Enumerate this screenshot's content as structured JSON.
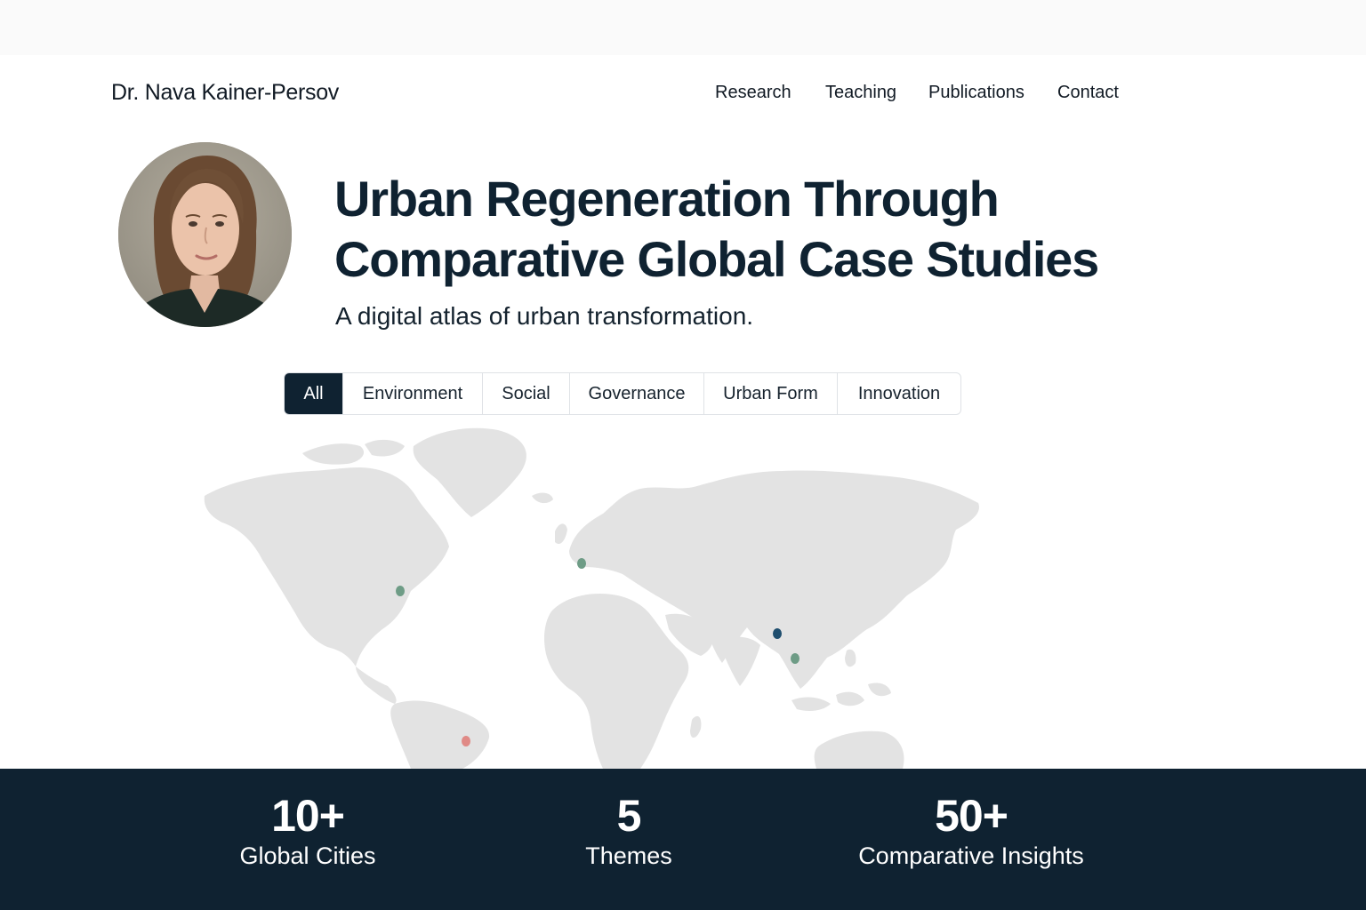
{
  "header": {
    "site_title": "Dr. Nava Kainer-Persov",
    "nav": [
      {
        "label": "Research"
      },
      {
        "label": "Teaching"
      },
      {
        "label": "Publications"
      },
      {
        "label": "Contact"
      }
    ]
  },
  "hero": {
    "title": "Urban Regeneration Through Comparative Global Case Studies",
    "subtitle": "A digital atlas of urban transformation."
  },
  "filters": {
    "selected": "All",
    "items": [
      {
        "label": "All"
      },
      {
        "label": "Environment"
      },
      {
        "label": "Social"
      },
      {
        "label": "Governance"
      },
      {
        "label": "Urban Form"
      },
      {
        "label": "Innovation"
      }
    ]
  },
  "map": {
    "land_color": "#e3e3e3",
    "markers": [
      {
        "name": "north-america-east",
        "color": "#6e9c86"
      },
      {
        "name": "western-europe",
        "color": "#6e9c86"
      },
      {
        "name": "east-asia",
        "color": "#1f4e6e"
      },
      {
        "name": "southeast-asia",
        "color": "#6e9c86"
      },
      {
        "name": "south-america",
        "color": "#e08a86"
      }
    ]
  },
  "stats": [
    {
      "value": "10+",
      "label": "Global Cities"
    },
    {
      "value": "5",
      "label": "Themes"
    },
    {
      "value": "50+",
      "label": "Comparative Insights"
    }
  ],
  "colors": {
    "navy": "#0f2231",
    "accent_green": "#6e9c86",
    "accent_blue": "#1f4e6e",
    "accent_red": "#e08a86"
  }
}
